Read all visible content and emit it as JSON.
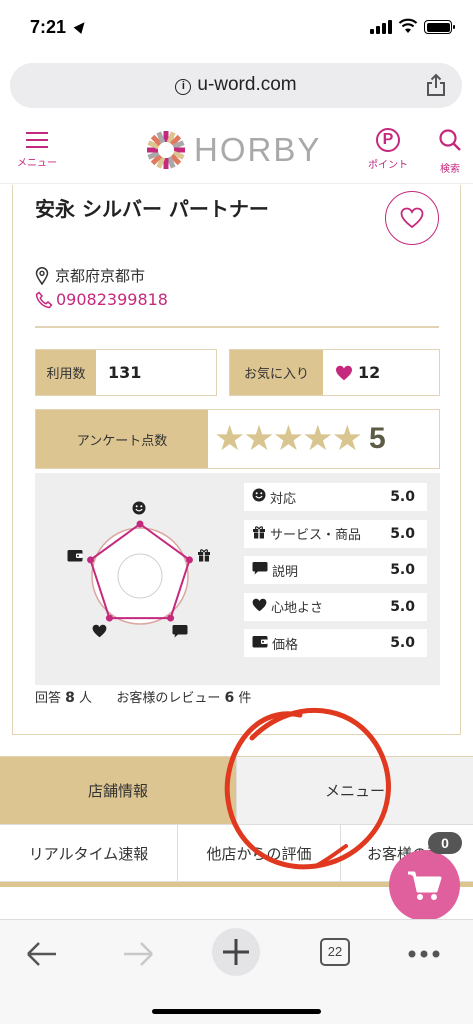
{
  "status_bar": {
    "time": "7:21"
  },
  "browser": {
    "url": "u-word.com",
    "tab_count": "22"
  },
  "header": {
    "menu_label": "メニュー",
    "logo_text": "HORBY",
    "point_label": "ポイント",
    "point_letter": "P",
    "search_label": "検索"
  },
  "shop": {
    "name": "安永 シルバー パートナー",
    "address": "京都府京都市",
    "phone": "09082399818"
  },
  "stats": {
    "usage_label": "利用数",
    "usage_value": "131",
    "favorite_label": "お気に入り",
    "favorite_value": "12"
  },
  "survey": {
    "label": "アンケート点数",
    "stars_filled": 5,
    "stars_total": 5,
    "score": "5",
    "ratings": [
      {
        "icon": "smiley-icon",
        "label": "対応",
        "value": "5.0"
      },
      {
        "icon": "gift-icon",
        "label": "サービス・商品",
        "value": "5.0"
      },
      {
        "icon": "speech-bubble-icon",
        "label": "説明",
        "value": "5.0"
      },
      {
        "icon": "heart-icon",
        "label": "心地よさ",
        "value": "5.0"
      },
      {
        "icon": "wallet-icon",
        "label": "価格",
        "value": "5.0"
      }
    ],
    "answers_label": "回答",
    "answers_count": "8",
    "answers_unit": "人",
    "reviews_label": "お客様のレビュー",
    "reviews_count": "6",
    "reviews_unit": "件"
  },
  "tabs": {
    "primary": [
      {
        "label": "店舗情報",
        "active": true
      },
      {
        "label": "メニュー",
        "active": false
      }
    ],
    "secondary": [
      {
        "label": "リアルタイム速報"
      },
      {
        "label": "他店からの評価"
      },
      {
        "label": "お客様の声"
      }
    ]
  },
  "cart": {
    "count": "0"
  },
  "colors": {
    "accent": "#c5297d",
    "gold": "#dcc591",
    "star": "#d8c590",
    "cart": "#e0609e",
    "annotation": "#e0391f"
  }
}
